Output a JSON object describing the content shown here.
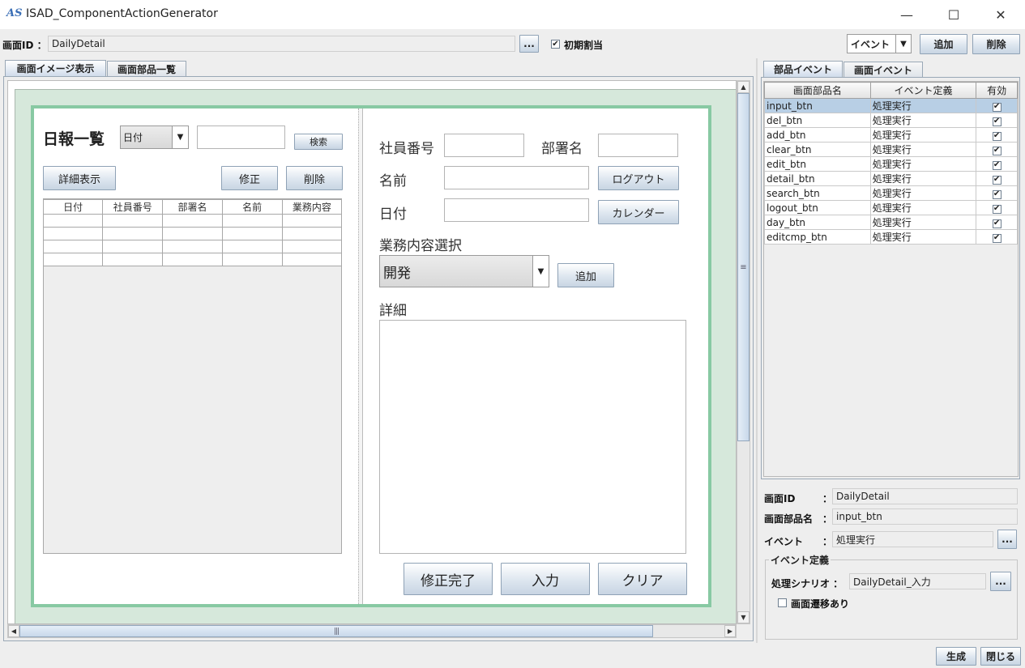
{
  "window": {
    "title": "ISAD_ComponentActionGenerator",
    "icon_text": "AS",
    "minimize": "—",
    "maximize": "☐",
    "close": "✕"
  },
  "toolbar": {
    "screen_id_label": "画面ID ：",
    "screen_id_value": "DailyDetail",
    "browse_label": "...",
    "initial_assign_label": "初期割当",
    "initial_assign_checked": true,
    "type_select_value": "イベント",
    "add_label": "追加",
    "delete_label": "削除"
  },
  "left_tabs": [
    {
      "label": "画面イメージ表示",
      "selected": true
    },
    {
      "label": "画面部品一覧",
      "selected": false
    }
  ],
  "preview": {
    "list_title": "日報一覧",
    "search_combo_value": "日付",
    "search_button": "検索",
    "detail_button": "詳細表示",
    "edit_button": "修正",
    "delete_button": "削除",
    "grid_headers": [
      "日付",
      "社員番号",
      "部署名",
      "名前",
      "業務内容"
    ],
    "emp_no_label": "社員番号",
    "dept_label": "部署名",
    "name_label": "名前",
    "logout_button": "ログアウト",
    "date_label": "日付",
    "calendar_button": "カレンダー",
    "task_select_label": "業務内容選択",
    "task_combo_value": "開発",
    "task_add_button": "追加",
    "detail_label": "詳細",
    "edit_complete_button": "修正完了",
    "input_button": "入力",
    "clear_button": "クリア"
  },
  "right_tabs": [
    {
      "label": "部品イベント",
      "selected": true
    },
    {
      "label": "画面イベント",
      "selected": false
    }
  ],
  "event_table": {
    "headers": [
      "画面部品名",
      "イベント定義",
      "有効"
    ],
    "rows": [
      {
        "name": "input_btn",
        "event": "処理実行",
        "enabled": true,
        "selected": true
      },
      {
        "name": "del_btn",
        "event": "処理実行",
        "enabled": true,
        "selected": false
      },
      {
        "name": "add_btn",
        "event": "処理実行",
        "enabled": true,
        "selected": false
      },
      {
        "name": "clear_btn",
        "event": "処理実行",
        "enabled": true,
        "selected": false
      },
      {
        "name": "edit_btn",
        "event": "処理実行",
        "enabled": true,
        "selected": false
      },
      {
        "name": "detail_btn",
        "event": "処理実行",
        "enabled": true,
        "selected": false
      },
      {
        "name": "search_btn",
        "event": "処理実行",
        "enabled": true,
        "selected": false
      },
      {
        "name": "logout_btn",
        "event": "処理実行",
        "enabled": true,
        "selected": false
      },
      {
        "name": "day_btn",
        "event": "処理実行",
        "enabled": true,
        "selected": false
      },
      {
        "name": "editcmp_btn",
        "event": "処理実行",
        "enabled": true,
        "selected": false
      }
    ]
  },
  "details": {
    "screen_id_label": "画面ID",
    "screen_id_value": "DailyDetail",
    "part_name_label": "画面部品名",
    "part_name_value": "input_btn",
    "event_label": "イベント",
    "event_value": "処理実行",
    "colon": "：",
    "browse_label": "...",
    "event_def_group": "イベント定義",
    "scenario_label": "処理シナリオ ：",
    "scenario_value": "DailyDetail_入力",
    "transition_label": "画面遷移あり",
    "transition_checked": false
  },
  "footer": {
    "generate_label": "生成",
    "close_label": "閉じる"
  },
  "icons": {
    "check_mark": "✔",
    "arrow_down": "▼",
    "arrow_up": "▲",
    "arrow_left": "◀",
    "arrow_right": "▶",
    "grip": "≡"
  }
}
